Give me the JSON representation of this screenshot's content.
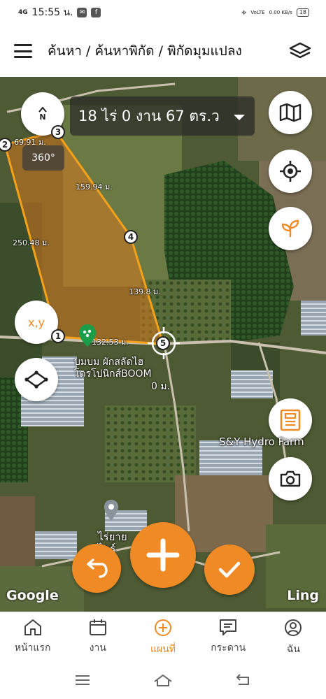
{
  "status_bar": {
    "network": "4G",
    "time": "15:55 น.",
    "volte": "VoLTE",
    "speed": "0.00 KB/s",
    "battery": "18"
  },
  "app_bar": {
    "breadcrumb": "ค้นหา / ค้นหาพิกัด / พิกัดมุมแปลง"
  },
  "map": {
    "area_text": "18 ไร่ 0 งาน 67 ตร.ว",
    "bearing": "360°",
    "compass_label": "N",
    "xy_button": "x,y",
    "edges": [
      {
        "label": "69.91 ม."
      },
      {
        "label": "159.94 ม."
      },
      {
        "label": "139.8 ม."
      },
      {
        "label": "132.53 ม."
      },
      {
        "label": "250.48 ม."
      }
    ],
    "vertices": [
      "1",
      "2",
      "3",
      "4",
      "5"
    ],
    "current_length": "0 ม.",
    "poi_1": "บมบม ผักสลัดไฮ\nโดรโปนิกส์BOOM",
    "poi_2": "S&Y Hydro Farm",
    "poi_3": "ไร่ยาย\nไดร์",
    "google_logo": "Google",
    "ling_label": "Ling"
  },
  "bottom_nav": {
    "items": [
      {
        "label": "หน้าแรก",
        "icon": "home-icon"
      },
      {
        "label": "งาน",
        "icon": "calendar-icon"
      },
      {
        "label": "แผนที่",
        "icon": "add-circle-icon",
        "active": true
      },
      {
        "label": "กระดาน",
        "icon": "board-icon"
      },
      {
        "label": "ฉัน",
        "icon": "profile-icon"
      }
    ]
  },
  "colors": {
    "accent": "#f08a24",
    "polygon_fill": "#d4761e",
    "polygon_stroke": "#f5a11a"
  }
}
